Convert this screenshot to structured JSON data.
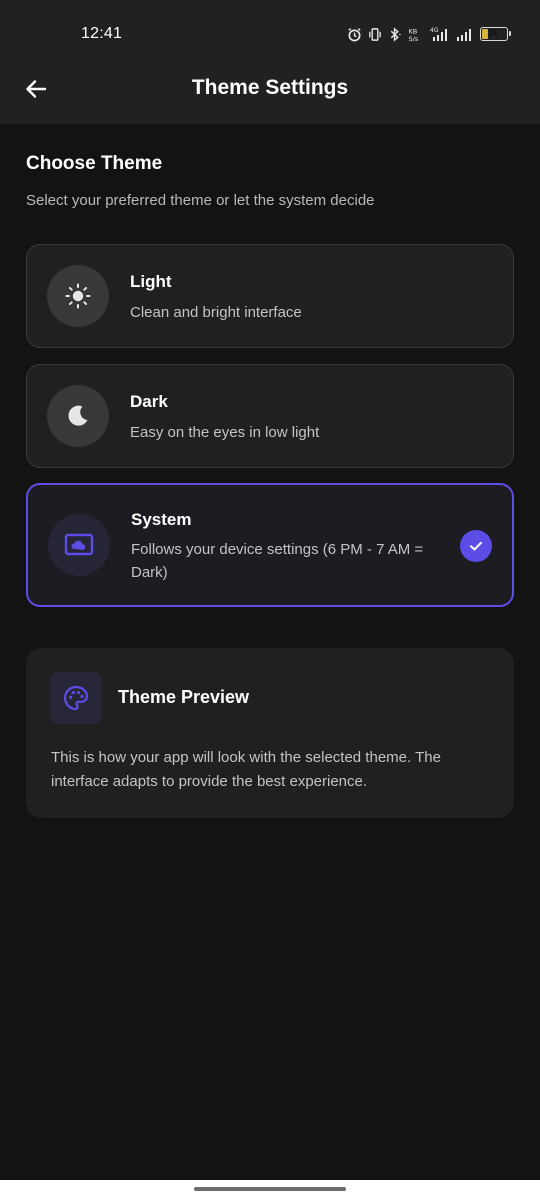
{
  "status_bar": {
    "time": "12:41",
    "battery_level": "24"
  },
  "header": {
    "title": "Theme Settings"
  },
  "section": {
    "title": "Choose Theme",
    "subtitle": "Select your preferred theme or let the system decide"
  },
  "options": [
    {
      "title": "Light",
      "description": "Clean and bright interface",
      "icon": "sun-icon",
      "selected": false
    },
    {
      "title": "Dark",
      "description": "Easy on the eyes in low light",
      "icon": "moon-icon",
      "selected": false
    },
    {
      "title": "System",
      "description": "Follows your device settings (6 PM - 7 AM = Dark)",
      "icon": "monitor-icon",
      "selected": true
    }
  ],
  "preview": {
    "title": "Theme Preview",
    "text": "This is how your app will look with the selected theme. The interface adapts to provide the best experience.",
    "icon": "palette-icon"
  },
  "colors": {
    "accent": "#5b4de6",
    "background": "#131313",
    "card": "#202020",
    "app_bar": "#212121"
  }
}
